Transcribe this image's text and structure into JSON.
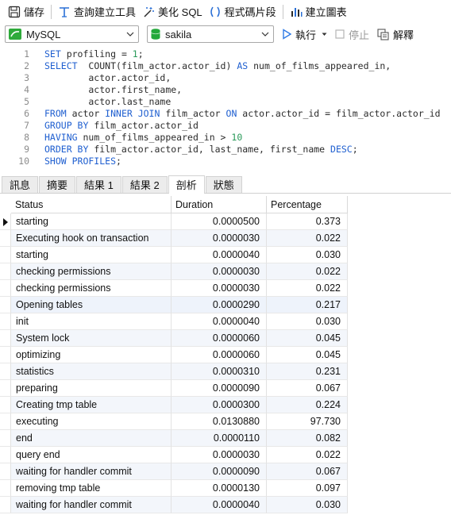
{
  "toolbar": {
    "save_label": "儲存",
    "query_builder_label": "查詢建立工具",
    "beautify_label": "美化 SQL",
    "snippet_label": "程式碼片段",
    "chart_label": "建立圖表"
  },
  "toolbar2": {
    "connection": "MySQL",
    "database": "sakila",
    "run_label": "執行",
    "stop_label": "停止",
    "explain_label": "解釋"
  },
  "editor": {
    "line_numbers": [
      "1",
      "2",
      "3",
      "4",
      "5",
      "6",
      "7",
      "8",
      "9",
      "10"
    ]
  },
  "tabs": [
    "訊息",
    "摘要",
    "結果 1",
    "結果 2",
    "剖析",
    "狀態"
  ],
  "active_tab": "剖析",
  "grid": {
    "columns": [
      "Status",
      "Duration",
      "Percentage"
    ],
    "rows": [
      {
        "status": "starting",
        "duration": "0.0000500",
        "percentage": "0.373"
      },
      {
        "status": "Executing hook on transaction",
        "duration": "0.0000030",
        "percentage": "0.022"
      },
      {
        "status": "starting",
        "duration": "0.0000040",
        "percentage": "0.030"
      },
      {
        "status": "checking permissions",
        "duration": "0.0000030",
        "percentage": "0.022"
      },
      {
        "status": "checking permissions",
        "duration": "0.0000030",
        "percentage": "0.022"
      },
      {
        "status": "Opening tables",
        "duration": "0.0000290",
        "percentage": "0.217"
      },
      {
        "status": "init",
        "duration": "0.0000040",
        "percentage": "0.030"
      },
      {
        "status": "System lock",
        "duration": "0.0000060",
        "percentage": "0.045"
      },
      {
        "status": "optimizing",
        "duration": "0.0000060",
        "percentage": "0.045"
      },
      {
        "status": "statistics",
        "duration": "0.0000310",
        "percentage": "0.231"
      },
      {
        "status": "preparing",
        "duration": "0.0000090",
        "percentage": "0.067"
      },
      {
        "status": "Creating tmp table",
        "duration": "0.0000300",
        "percentage": "0.224"
      },
      {
        "status": "executing",
        "duration": "0.0130880",
        "percentage": "97.730"
      },
      {
        "status": "end",
        "duration": "0.0000110",
        "percentage": "0.082"
      },
      {
        "status": "query end",
        "duration": "0.0000030",
        "percentage": "0.022"
      },
      {
        "status": "waiting for handler commit",
        "duration": "0.0000090",
        "percentage": "0.067"
      },
      {
        "status": "removing tmp table",
        "duration": "0.0000130",
        "percentage": "0.097"
      },
      {
        "status": "waiting for handler commit",
        "duration": "0.0000040",
        "percentage": "0.030"
      }
    ]
  },
  "colors": {
    "keyword": "#1f5fd0",
    "number": "#2a9a5a",
    "mysql_icon": "#2eaa3a",
    "db_icon": "#23a83a",
    "run_icon": "#2f7ae5"
  }
}
